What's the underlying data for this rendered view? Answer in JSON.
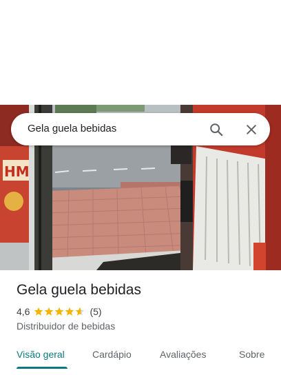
{
  "search": {
    "query": "Gela guela bebidas"
  },
  "place": {
    "name": "Gela guela bebidas",
    "rating": "4,6",
    "rating_value": 4.6,
    "review_count": "(5)",
    "category": "Distribuidor de bebidas"
  },
  "tabs": [
    {
      "label": "Visão geral",
      "active": true
    },
    {
      "label": "Cardápio",
      "active": false
    },
    {
      "label": "Avaliações",
      "active": false
    },
    {
      "label": "Sobre",
      "active": false
    }
  ],
  "colors": {
    "accent": "#0b7a7f",
    "star": "#f4b400",
    "star_empty": "#dadce0"
  },
  "icons": [
    "search-icon",
    "close-icon",
    "star-icon"
  ]
}
